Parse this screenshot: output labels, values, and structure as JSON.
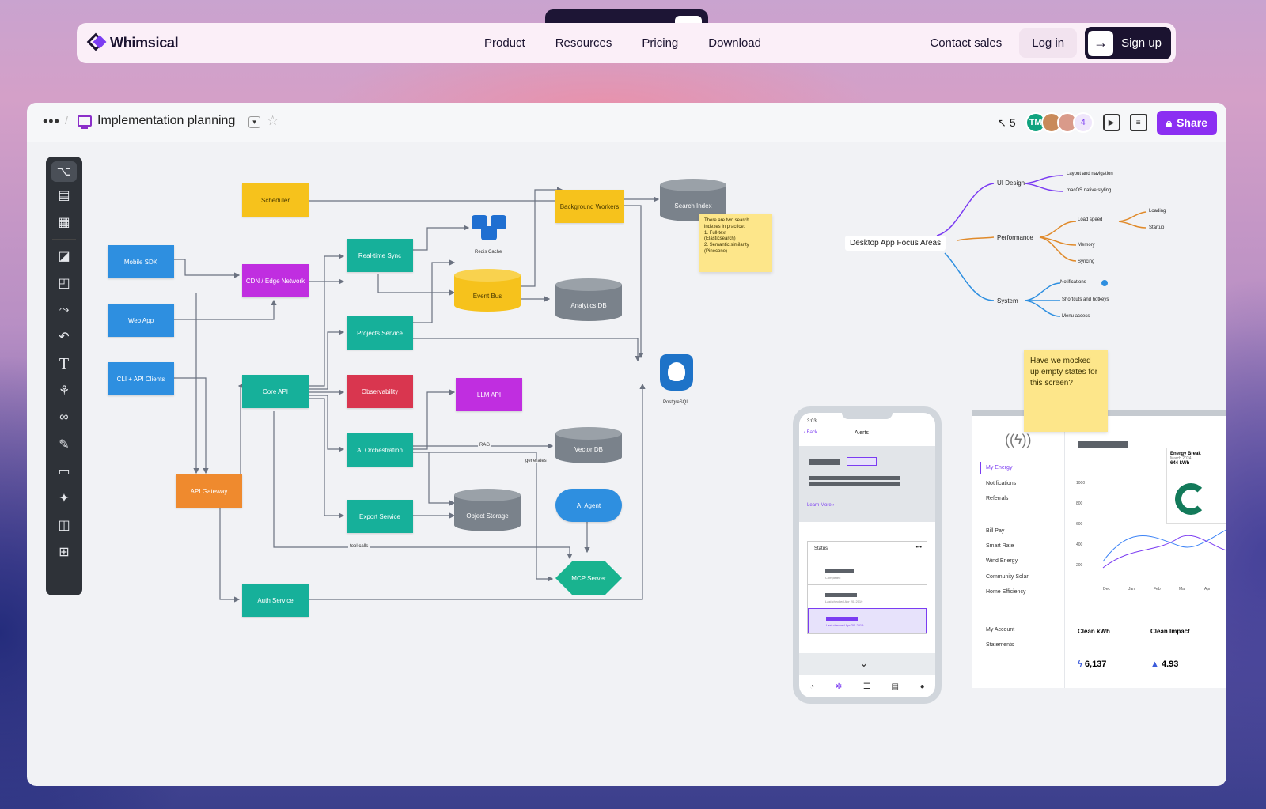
{
  "nav": {
    "brand": "Whimsical",
    "links": [
      "Product",
      "Resources",
      "Pricing",
      "Download"
    ],
    "contact": "Contact sales",
    "login": "Log in",
    "signup": "Sign up"
  },
  "header": {
    "board_title": "Implementation planning",
    "cursor_count": "5",
    "avatar_initials": "TM",
    "extra_avatars": "4",
    "share": "Share"
  },
  "toolbar": {
    "icons": [
      "flowchart-icon",
      "wireframe-icon",
      "grid-icon",
      "shapes-icon",
      "sticky-icon",
      "connector-icon",
      "undo-icon",
      "text-icon",
      "mindmap-icon",
      "link-icon",
      "pen-icon",
      "frame-icon",
      "ai-sparkle-icon",
      "layout-icon",
      "add-icon"
    ]
  },
  "flow": {
    "nodes": {
      "scheduler": "Scheduler",
      "mobile_sdk": "Mobile SDK",
      "web_app": "Web App",
      "cli": "CLI + API Clients",
      "cdn": "CDN / Edge Network",
      "realtime": "Real-time Sync",
      "projects": "Projects Service",
      "core_api": "Core API",
      "observability": "Observability",
      "ai_orch": "AI Orchestration",
      "export": "Export Service",
      "api_gateway": "API Gateway",
      "auth": "Auth Service",
      "background": "Background Workers",
      "llm_api": "LLM API",
      "ai_agent": "AI Agent",
      "mcp": "MCP Server"
    },
    "cylinders": {
      "search": "Search Index",
      "event_bus": "Event Bus",
      "analytics": "Analytics DB",
      "vector": "Vector DB",
      "object": "Object Storage"
    },
    "labels": {
      "redis": "Redis Cache",
      "postgres": "PostgreSQL",
      "rag": "RAG",
      "generates": "generates",
      "tool_calls": "tool calls"
    },
    "search_note": [
      "There are two search",
      "indexes in practice:",
      "1.  Full-text",
      "     (Elasticsearch)",
      "2.  Semantic similarity",
      "     (Pinecone)"
    ]
  },
  "mindmap": {
    "root": "Desktop App Focus Areas",
    "ui_design": "UI Design",
    "layout_nav": "Layout and navigation",
    "macos": "macOS native styling",
    "performance": "Performance",
    "load_speed": "Load speed",
    "loading": "Loading",
    "startup": "Startup",
    "memory": "Memory",
    "syncing": "Syncing",
    "system": "System",
    "notifications": "Notifications",
    "shortcuts": "Shortcuts and hotkeys",
    "menu_access": "Menu access"
  },
  "sticky_question": "Have we mocked up empty states for this screen?",
  "phone": {
    "time": "3:03",
    "back": "Back",
    "title": "Alerts",
    "learn_more": "Learn More  ›",
    "status": "Status",
    "row1_sub": "Completed",
    "row2_sub": "Last checked Apr 20, 2019",
    "row3_sub": "Last checked Apr 20, 2019"
  },
  "energy": {
    "side_items": [
      "My Energy",
      "Notifications",
      "Referrals",
      "Bill Pay",
      "Smart Rate",
      "Wind Energy",
      "Community Solar",
      "Home Efficiency",
      "My Account",
      "Statements"
    ],
    "card_title": "Energy Break",
    "card_date": "March 2024",
    "card_value": "644 kWh",
    "y_ticks": [
      "1000",
      "800",
      "600",
      "400",
      "200"
    ],
    "x_ticks": [
      "Dec",
      "Jan",
      "Feb",
      "Mar",
      "Apr"
    ],
    "clean_kwh_label": "Clean kWh",
    "clean_kwh_value": "6,137",
    "clean_impact_label": "Clean Impact",
    "clean_impact_value": "4.93"
  },
  "colors": {
    "brand": "#7b3cf2",
    "share": "#8b2ff2",
    "toolbar": "#2e3238"
  }
}
